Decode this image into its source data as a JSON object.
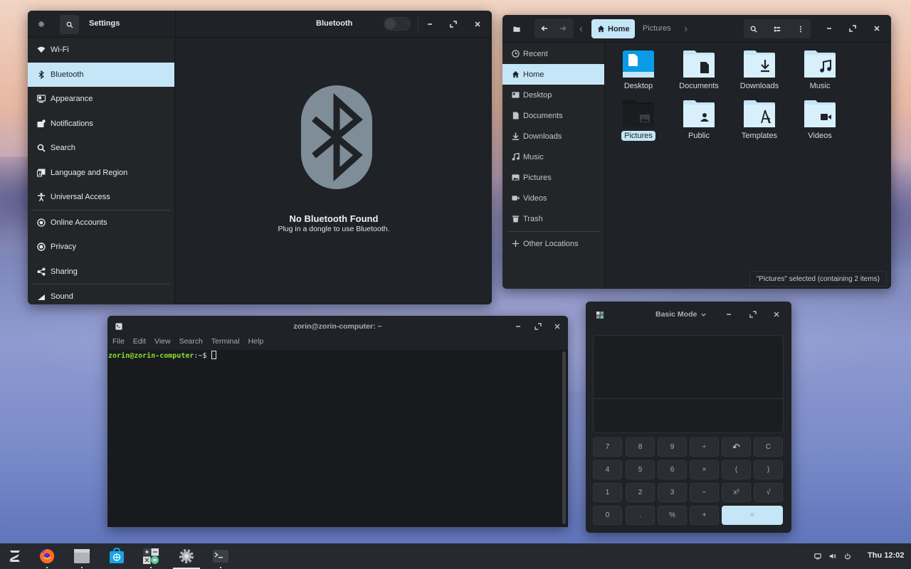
{
  "settings": {
    "title": "Settings",
    "panel_title": "Bluetooth",
    "sidebar": [
      {
        "label": "Wi-Fi",
        "icon": "wifi-icon"
      },
      {
        "label": "Bluetooth",
        "icon": "bluetooth-icon",
        "active": true
      },
      {
        "label": "Appearance",
        "icon": "appearance-icon"
      },
      {
        "label": "Notifications",
        "icon": "notifications-icon"
      },
      {
        "label": "Search",
        "icon": "search-icon"
      },
      {
        "label": "Language and Region",
        "icon": "language-icon"
      },
      {
        "label": "Universal Access",
        "icon": "accessibility-icon"
      },
      {
        "label": "Online Accounts",
        "icon": "online-accounts-icon"
      },
      {
        "label": "Privacy",
        "icon": "privacy-icon"
      },
      {
        "label": "Sharing",
        "icon": "sharing-icon"
      },
      {
        "label": "Sound",
        "icon": "sound-icon"
      }
    ],
    "bt_status_title": "No Bluetooth Found",
    "bt_status_sub": "Plug in a dongle to use Bluetooth.",
    "bt_toggle_on": false
  },
  "files": {
    "path": [
      "Home",
      "Pictures"
    ],
    "sidebar": [
      {
        "label": "Recent",
        "icon": "recent-icon"
      },
      {
        "label": "Home",
        "icon": "home-icon",
        "active": true
      },
      {
        "label": "Desktop",
        "icon": "desktop-icon"
      },
      {
        "label": "Documents",
        "icon": "documents-icon"
      },
      {
        "label": "Downloads",
        "icon": "downloads-icon"
      },
      {
        "label": "Music",
        "icon": "music-icon"
      },
      {
        "label": "Pictures",
        "icon": "pictures-icon"
      },
      {
        "label": "Videos",
        "icon": "videos-icon"
      },
      {
        "label": "Trash",
        "icon": "trash-icon"
      },
      {
        "label": "Other Locations",
        "icon": "plus-icon"
      }
    ],
    "folders": [
      {
        "label": "Desktop"
      },
      {
        "label": "Documents"
      },
      {
        "label": "Downloads"
      },
      {
        "label": "Music"
      },
      {
        "label": "Pictures",
        "selected": true
      },
      {
        "label": "Public"
      },
      {
        "label": "Templates"
      },
      {
        "label": "Videos"
      }
    ],
    "status": "\"Pictures\" selected  (containing 2 items)"
  },
  "terminal": {
    "title": "zorin@zorin-computer: ~",
    "menu": [
      "File",
      "Edit",
      "View",
      "Search",
      "Terminal",
      "Help"
    ],
    "prompt_user": "zorin@zorin-computer",
    "prompt_path": ":~$ "
  },
  "calculator": {
    "mode": "Basic Mode",
    "keys": [
      [
        "7",
        "8",
        "9",
        "÷",
        "↶",
        "C"
      ],
      [
        "4",
        "5",
        "6",
        "×",
        "(",
        ")"
      ],
      [
        "1",
        "2",
        "3",
        "−",
        "x²",
        "√"
      ],
      [
        "0",
        ".",
        "%",
        "+",
        "="
      ]
    ]
  },
  "taskbar": {
    "apps": [
      "zorin-menu",
      "firefox",
      "files",
      "software",
      "calculator",
      "settings",
      "terminal"
    ],
    "clock": "Thu 12:02"
  },
  "colors": {
    "accent": "#c4e6f7",
    "terminal_prompt": "#8ae234",
    "folder": "#c4e6f7"
  }
}
